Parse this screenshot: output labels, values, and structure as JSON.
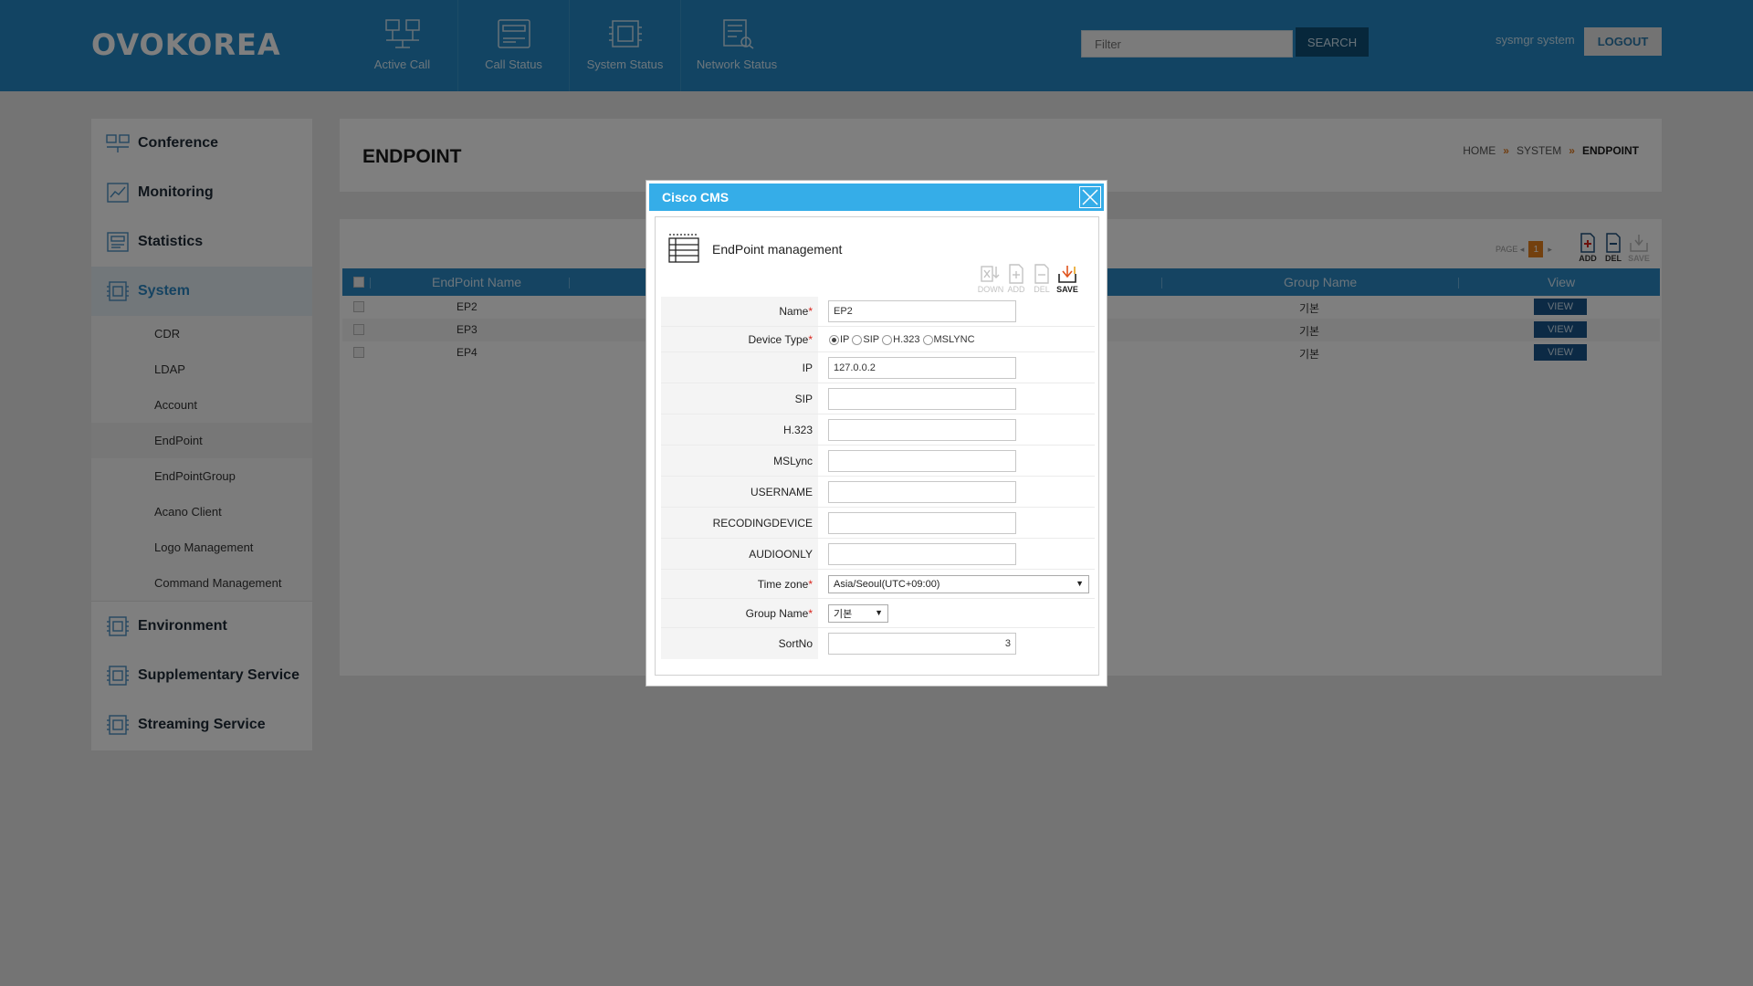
{
  "header": {
    "logo": "OVOKOREA",
    "nav": [
      {
        "label": "Active Call",
        "icon": "active-call-icon"
      },
      {
        "label": "Call Status",
        "icon": "call-status-icon"
      },
      {
        "label": "System Status",
        "icon": "system-status-icon"
      },
      {
        "label": "Network Status",
        "icon": "network-status-icon"
      }
    ],
    "filter_placeholder": "Filter",
    "search_label": "SEARCH",
    "user": "sysmgr system",
    "logout_label": "LOGOUT"
  },
  "sidebar": {
    "menu": [
      {
        "label": "Conference",
        "icon": "conference-icon"
      },
      {
        "label": "Monitoring",
        "icon": "monitoring-icon"
      },
      {
        "label": "Statistics",
        "icon": "statistics-icon"
      },
      {
        "label": "System",
        "icon": "system-icon",
        "active": true
      },
      {
        "label": "Environment",
        "icon": "environment-icon"
      },
      {
        "label": "Supplementary Service",
        "icon": "supplementary-icon"
      },
      {
        "label": "Streaming Service",
        "icon": "streaming-icon"
      }
    ],
    "system_submenu": [
      "CDR",
      "LDAP",
      "Account",
      "EndPoint",
      "EndPointGroup",
      "Acano Client",
      "Logo Management",
      "Command Management"
    ],
    "active_submenu": "EndPoint"
  },
  "page": {
    "title": "ENDPOINT",
    "breadcrumb": [
      "HOME",
      "SYSTEM",
      "ENDPOINT"
    ]
  },
  "list": {
    "page_label": "PAGE",
    "page_current": "1",
    "tools": {
      "add": "ADD",
      "del": "DEL",
      "save": "SAVE"
    },
    "columns": {
      "name": "EndPoint Name",
      "group": "Group Name",
      "view": "View"
    },
    "rows": [
      {
        "name": "EP2",
        "group": "기본",
        "view": "VIEW"
      },
      {
        "name": "EP3",
        "group": "기본",
        "view": "VIEW"
      },
      {
        "name": "EP4",
        "group": "기본",
        "view": "VIEW"
      }
    ]
  },
  "modal": {
    "title": "Cisco CMS",
    "heading": "EndPoint management",
    "tools": {
      "down": "DOWN",
      "add": "ADD",
      "del": "DEL",
      "save": "SAVE"
    },
    "labels": {
      "name": "Name",
      "device_type": "Device Type",
      "ip": "IP",
      "sip": "SIP",
      "h323": "H.323",
      "mslync": "MSLync",
      "username": "USERNAME",
      "recodingdevice": "RECODINGDEVICE",
      "audioonly": "AUDIOONLY",
      "timezone": "Time zone",
      "group_name": "Group Name",
      "sortno": "SortNo"
    },
    "required_mark": "*",
    "device_types": [
      "IP",
      "SIP",
      "H.323",
      "MSLYNC"
    ],
    "device_type_selected": "IP",
    "values": {
      "name": "EP2",
      "ip": "127.0.0.2",
      "sip": "",
      "h323": "",
      "mslync": "",
      "username": "",
      "recodingdevice": "",
      "audioonly": "",
      "timezone": "Asia/Seoul(UTC+09:00)",
      "group_name": "기본",
      "sortno": "3"
    }
  }
}
